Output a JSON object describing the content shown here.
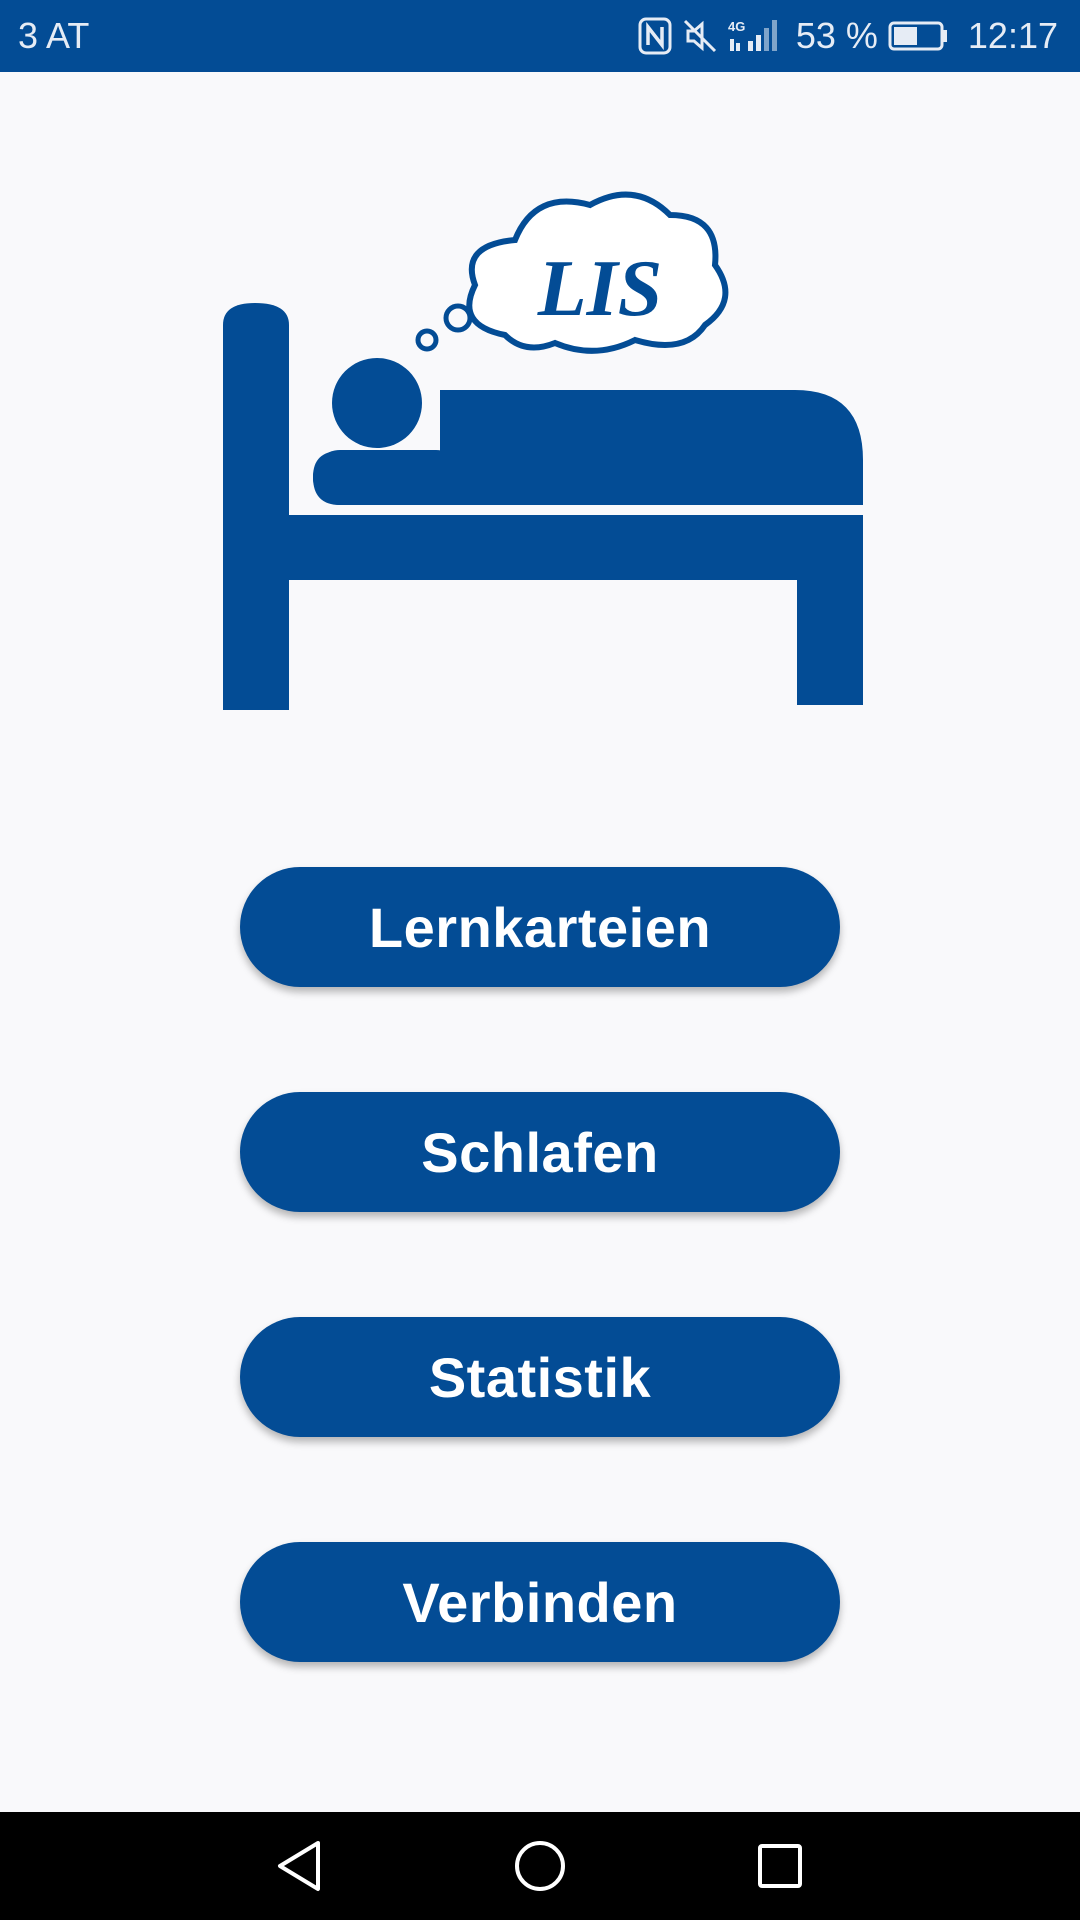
{
  "status_bar": {
    "carrier": "3 AT",
    "battery_percent": "53 %",
    "time": "12:17",
    "network_label": "4G",
    "icons": [
      "nfc-icon",
      "mute-icon",
      "signal-icon",
      "battery-icon"
    ],
    "battery_level": 0.53
  },
  "logo": {
    "icon": "sleeping-person-bed-icon",
    "cloud_text": "LIS"
  },
  "menu": {
    "buttons": [
      {
        "label": "Lernkarteien"
      },
      {
        "label": "Schlafen"
      },
      {
        "label": "Statistik"
      },
      {
        "label": "Verbinden"
      }
    ]
  },
  "nav_bar": {
    "icons": [
      "back-icon",
      "home-icon",
      "recent-apps-icon"
    ]
  },
  "colors": {
    "primary": "#034c95",
    "background": "#f9f9fb",
    "nav_background": "#000000",
    "button_text": "#ffffff"
  }
}
